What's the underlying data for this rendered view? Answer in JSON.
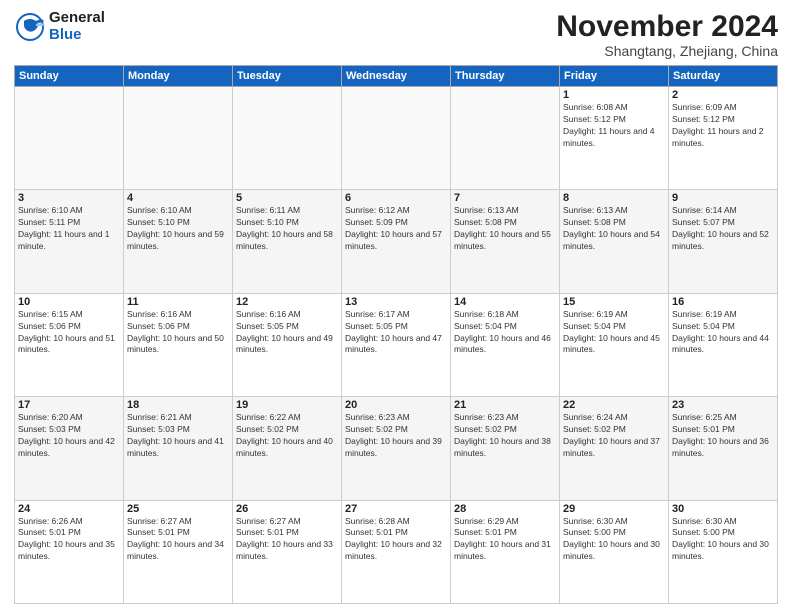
{
  "header": {
    "logo_general": "General",
    "logo_blue": "Blue",
    "month_title": "November 2024",
    "location": "Shangtang, Zhejiang, China"
  },
  "weekdays": [
    "Sunday",
    "Monday",
    "Tuesday",
    "Wednesday",
    "Thursday",
    "Friday",
    "Saturday"
  ],
  "weeks": [
    [
      {
        "day": "",
        "info": ""
      },
      {
        "day": "",
        "info": ""
      },
      {
        "day": "",
        "info": ""
      },
      {
        "day": "",
        "info": ""
      },
      {
        "day": "",
        "info": ""
      },
      {
        "day": "1",
        "info": "Sunrise: 6:08 AM\nSunset: 5:12 PM\nDaylight: 11 hours and 4 minutes."
      },
      {
        "day": "2",
        "info": "Sunrise: 6:09 AM\nSunset: 5:12 PM\nDaylight: 11 hours and 2 minutes."
      }
    ],
    [
      {
        "day": "3",
        "info": "Sunrise: 6:10 AM\nSunset: 5:11 PM\nDaylight: 11 hours and 1 minute."
      },
      {
        "day": "4",
        "info": "Sunrise: 6:10 AM\nSunset: 5:10 PM\nDaylight: 10 hours and 59 minutes."
      },
      {
        "day": "5",
        "info": "Sunrise: 6:11 AM\nSunset: 5:10 PM\nDaylight: 10 hours and 58 minutes."
      },
      {
        "day": "6",
        "info": "Sunrise: 6:12 AM\nSunset: 5:09 PM\nDaylight: 10 hours and 57 minutes."
      },
      {
        "day": "7",
        "info": "Sunrise: 6:13 AM\nSunset: 5:08 PM\nDaylight: 10 hours and 55 minutes."
      },
      {
        "day": "8",
        "info": "Sunrise: 6:13 AM\nSunset: 5:08 PM\nDaylight: 10 hours and 54 minutes."
      },
      {
        "day": "9",
        "info": "Sunrise: 6:14 AM\nSunset: 5:07 PM\nDaylight: 10 hours and 52 minutes."
      }
    ],
    [
      {
        "day": "10",
        "info": "Sunrise: 6:15 AM\nSunset: 5:06 PM\nDaylight: 10 hours and 51 minutes."
      },
      {
        "day": "11",
        "info": "Sunrise: 6:16 AM\nSunset: 5:06 PM\nDaylight: 10 hours and 50 minutes."
      },
      {
        "day": "12",
        "info": "Sunrise: 6:16 AM\nSunset: 5:05 PM\nDaylight: 10 hours and 49 minutes."
      },
      {
        "day": "13",
        "info": "Sunrise: 6:17 AM\nSunset: 5:05 PM\nDaylight: 10 hours and 47 minutes."
      },
      {
        "day": "14",
        "info": "Sunrise: 6:18 AM\nSunset: 5:04 PM\nDaylight: 10 hours and 46 minutes."
      },
      {
        "day": "15",
        "info": "Sunrise: 6:19 AM\nSunset: 5:04 PM\nDaylight: 10 hours and 45 minutes."
      },
      {
        "day": "16",
        "info": "Sunrise: 6:19 AM\nSunset: 5:04 PM\nDaylight: 10 hours and 44 minutes."
      }
    ],
    [
      {
        "day": "17",
        "info": "Sunrise: 6:20 AM\nSunset: 5:03 PM\nDaylight: 10 hours and 42 minutes."
      },
      {
        "day": "18",
        "info": "Sunrise: 6:21 AM\nSunset: 5:03 PM\nDaylight: 10 hours and 41 minutes."
      },
      {
        "day": "19",
        "info": "Sunrise: 6:22 AM\nSunset: 5:02 PM\nDaylight: 10 hours and 40 minutes."
      },
      {
        "day": "20",
        "info": "Sunrise: 6:23 AM\nSunset: 5:02 PM\nDaylight: 10 hours and 39 minutes."
      },
      {
        "day": "21",
        "info": "Sunrise: 6:23 AM\nSunset: 5:02 PM\nDaylight: 10 hours and 38 minutes."
      },
      {
        "day": "22",
        "info": "Sunrise: 6:24 AM\nSunset: 5:02 PM\nDaylight: 10 hours and 37 minutes."
      },
      {
        "day": "23",
        "info": "Sunrise: 6:25 AM\nSunset: 5:01 PM\nDaylight: 10 hours and 36 minutes."
      }
    ],
    [
      {
        "day": "24",
        "info": "Sunrise: 6:26 AM\nSunset: 5:01 PM\nDaylight: 10 hours and 35 minutes."
      },
      {
        "day": "25",
        "info": "Sunrise: 6:27 AM\nSunset: 5:01 PM\nDaylight: 10 hours and 34 minutes."
      },
      {
        "day": "26",
        "info": "Sunrise: 6:27 AM\nSunset: 5:01 PM\nDaylight: 10 hours and 33 minutes."
      },
      {
        "day": "27",
        "info": "Sunrise: 6:28 AM\nSunset: 5:01 PM\nDaylight: 10 hours and 32 minutes."
      },
      {
        "day": "28",
        "info": "Sunrise: 6:29 AM\nSunset: 5:01 PM\nDaylight: 10 hours and 31 minutes."
      },
      {
        "day": "29",
        "info": "Sunrise: 6:30 AM\nSunset: 5:00 PM\nDaylight: 10 hours and 30 minutes."
      },
      {
        "day": "30",
        "info": "Sunrise: 6:30 AM\nSunset: 5:00 PM\nDaylight: 10 hours and 30 minutes."
      }
    ]
  ]
}
